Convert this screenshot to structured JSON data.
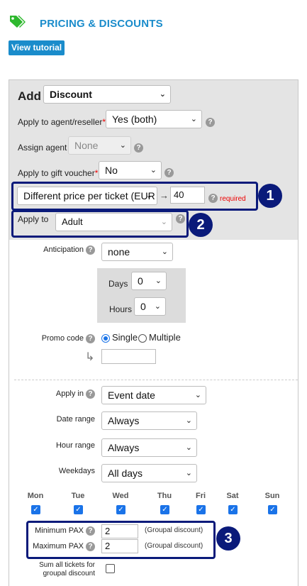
{
  "header": {
    "title": "PRICING & DISCOUNTS",
    "tutorial_button": "View tutorial",
    "icon": "tag-icon",
    "accent_color": "#1a8ccb"
  },
  "form": {
    "add_label": "Add",
    "add_type": "Discount",
    "apply_agent_label": "Apply to agent/reseller",
    "apply_agent_required": "*",
    "apply_agent_value": "Yes (both)",
    "assign_agent_label": "Assign agent",
    "assign_agent_value": "None",
    "gift_voucher_label": "Apply to gift voucher",
    "gift_voucher_required": "*",
    "gift_voucher_value": "No",
    "price_mode_value": "Different price per ticket (EUR",
    "price_arrow": "→",
    "price_amount": "40",
    "price_required": "required",
    "apply_to_label": "Apply to",
    "apply_to_value": "Adult",
    "anticipation_label": "Anticipation",
    "anticipation_value": "none",
    "days_label": "Days",
    "days_value": "0",
    "hours_label": "Hours",
    "hours_value": "0",
    "promo_label": "Promo code",
    "promo_single": "Single",
    "promo_multiple": "Multiple",
    "promo_arrow": "↳",
    "promo_value": "",
    "apply_in_label": "Apply in",
    "apply_in_value": "Event date",
    "date_range_label": "Date range",
    "date_range_value": "Always",
    "hour_range_label": "Hour range",
    "hour_range_value": "Always",
    "weekdays_label": "Weekdays",
    "weekdays_value": "All days",
    "days_of_week": [
      {
        "label": "Mon",
        "checked": true
      },
      {
        "label": "Tue",
        "checked": true
      },
      {
        "label": "Wed",
        "checked": true
      },
      {
        "label": "Thu",
        "checked": true
      },
      {
        "label": "Fri",
        "checked": true
      },
      {
        "label": "Sat",
        "checked": true
      },
      {
        "label": "Sun",
        "checked": true
      }
    ],
    "min_pax_label": "Minimum PAX",
    "min_pax_value": "2",
    "min_pax_note": "(Groupal discount)",
    "max_pax_label": "Maximum PAX",
    "max_pax_value": "2",
    "max_pax_note": "(Groupal discount)",
    "sum_all_label_1": "Sum all tickets for",
    "sum_all_label_2": "groupal discount"
  },
  "annotations": [
    "1",
    "2",
    "3"
  ],
  "help_glyph": "?",
  "chevron_glyph": "⌄"
}
